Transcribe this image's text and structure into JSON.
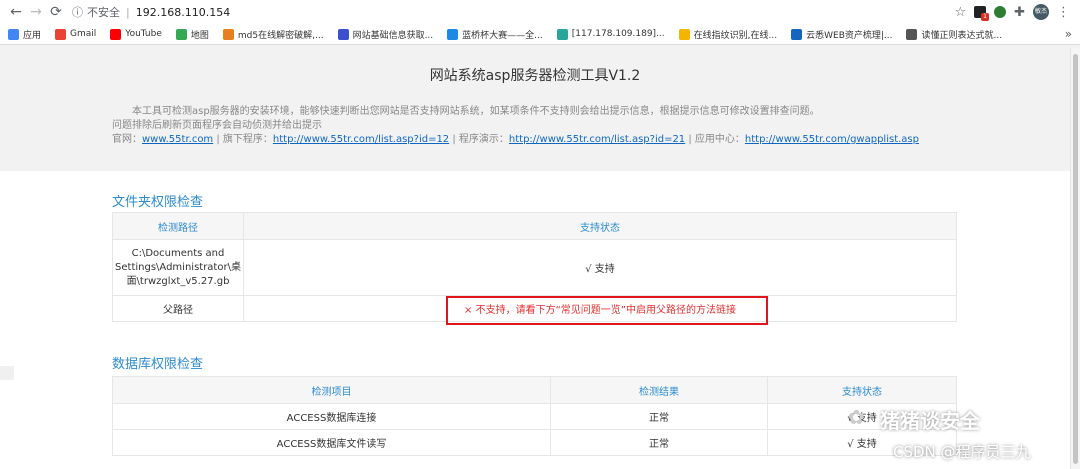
{
  "browser": {
    "security_label": "不安全",
    "url": "192.168.110.154",
    "bookmarks": [
      {
        "label": "应用",
        "color": "#4285f4"
      },
      {
        "label": "Gmail",
        "color": "#ea4335"
      },
      {
        "label": "YouTube",
        "color": "#ff0000"
      },
      {
        "label": "地图",
        "color": "#34a853"
      },
      {
        "label": "md5在线解密破解,...",
        "color": "#e67e22"
      },
      {
        "label": "网站基础信息获取...",
        "color": "#3b4fd1"
      },
      {
        "label": "蓝桥杯大赛——全...",
        "color": "#1e88e5"
      },
      {
        "label": "[117.178.109.189]...",
        "color": "#26a69a"
      },
      {
        "label": "在线指纹识别,在线...",
        "color": "#f4b400"
      },
      {
        "label": "云悉WEB资产梳理|...",
        "color": "#1565c0"
      },
      {
        "label": "读懂正则表达式就...",
        "color": "#555555"
      }
    ],
    "more": "»",
    "avatar_text": "敏杰"
  },
  "header": {
    "title": "网站系统asp服务器检测工具V1.2",
    "desc_line1": "本工具可检测asp服务器的安装环境，能够快速判断出您网站是否支持网站系统，如某项条件不支持则会给出提示信息，根据提示信息可修改设置排查问题。",
    "desc_line2": "问题排除后刷新页面程序会自动侦测并给出提示",
    "links": {
      "site_label": "官网：",
      "site_url": "www.55tr.com",
      "prog_label": " | 旗下程序：",
      "prog_url": "http://www.55tr.com/list.asp?id=12",
      "demo_label": " | 程序演示：",
      "demo_url": "http://www.55tr.com/list.asp?id=21",
      "app_label": " | 应用中心：",
      "app_url": "http://www.55tr.com/gwapplist.asp"
    }
  },
  "folder_check": {
    "title": "文件夹权限检查",
    "headers": [
      "检测路径",
      "支持状态"
    ],
    "rows": [
      {
        "path": "C:\\Documents and Settings\\Administrator\\桌面\\trwzglxt_v5.27.gb",
        "status": "√ 支持"
      },
      {
        "path": "父路径",
        "status": "× 不支持，请看下方“常见问题一览”中启用父路径的方法链接"
      }
    ]
  },
  "db_check": {
    "title": "数据库权限检查",
    "headers": [
      "检测项目",
      "检测结果",
      "支持状态"
    ],
    "rows": [
      {
        "item": "ACCESS数据库连接",
        "result": "正常",
        "status": "√ 支持"
      },
      {
        "item": "ACCESS数据库文件读写",
        "result": "正常",
        "status": "√ 支持"
      }
    ]
  },
  "watermark": {
    "line1": "猪猪谈安全",
    "line2": "CSDN @程序员三九"
  }
}
